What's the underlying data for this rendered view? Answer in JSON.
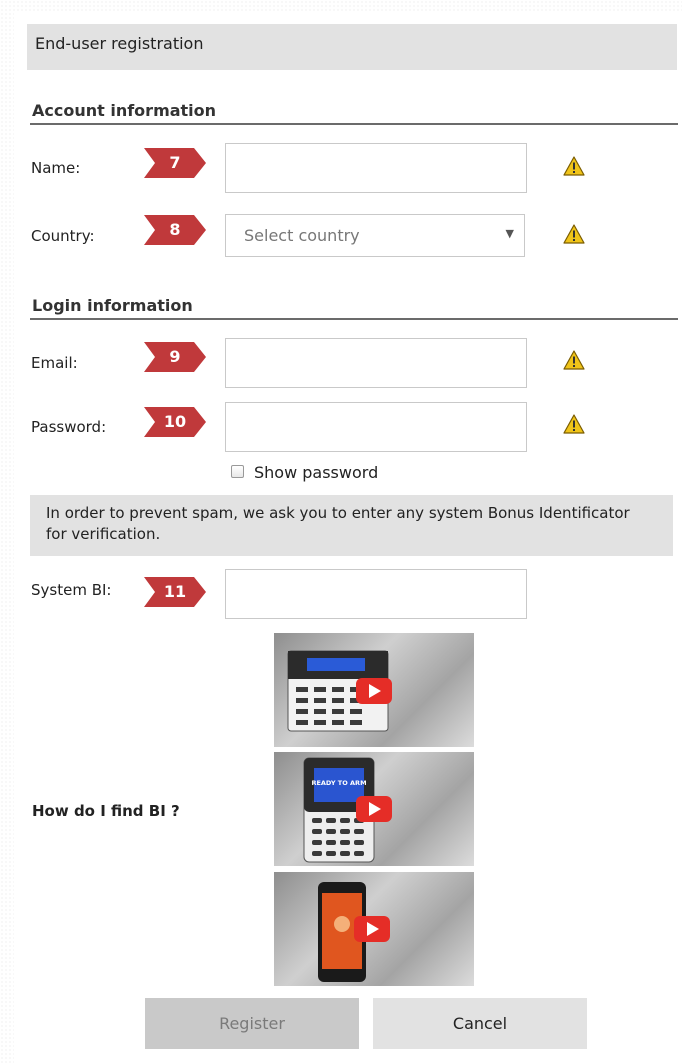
{
  "header": {
    "title": "End-user registration"
  },
  "account_section": {
    "title": "Account information",
    "name_label": "Name:",
    "name_value": "",
    "country_label": "Country:",
    "country_selected": "Select country"
  },
  "login_section": {
    "title": "Login information",
    "email_label": "Email:",
    "email_value": "",
    "password_label": "Password:",
    "password_value": "",
    "show_password_label": "Show password"
  },
  "markers": {
    "name": "7",
    "country": "8",
    "email": "9",
    "password": "10",
    "system_bi": "11"
  },
  "spam_notice": "In order to prevent spam, we ask you to enter any system Bonus Identificator for verification.",
  "system_bi": {
    "label": "System BI:",
    "value": ""
  },
  "help": {
    "question": "How do I find BI ?"
  },
  "videos": {
    "keypad_display": "READY TO ARM",
    "items": [
      "keypad-lcd-video",
      "keypad-blue-video",
      "mobile-app-video"
    ]
  },
  "buttons": {
    "register": "Register",
    "cancel": "Cancel"
  },
  "colors": {
    "marker": "#c0393b",
    "warning": "#f0c419",
    "play": "#e52d27",
    "header_bg": "#e2e2e2"
  }
}
